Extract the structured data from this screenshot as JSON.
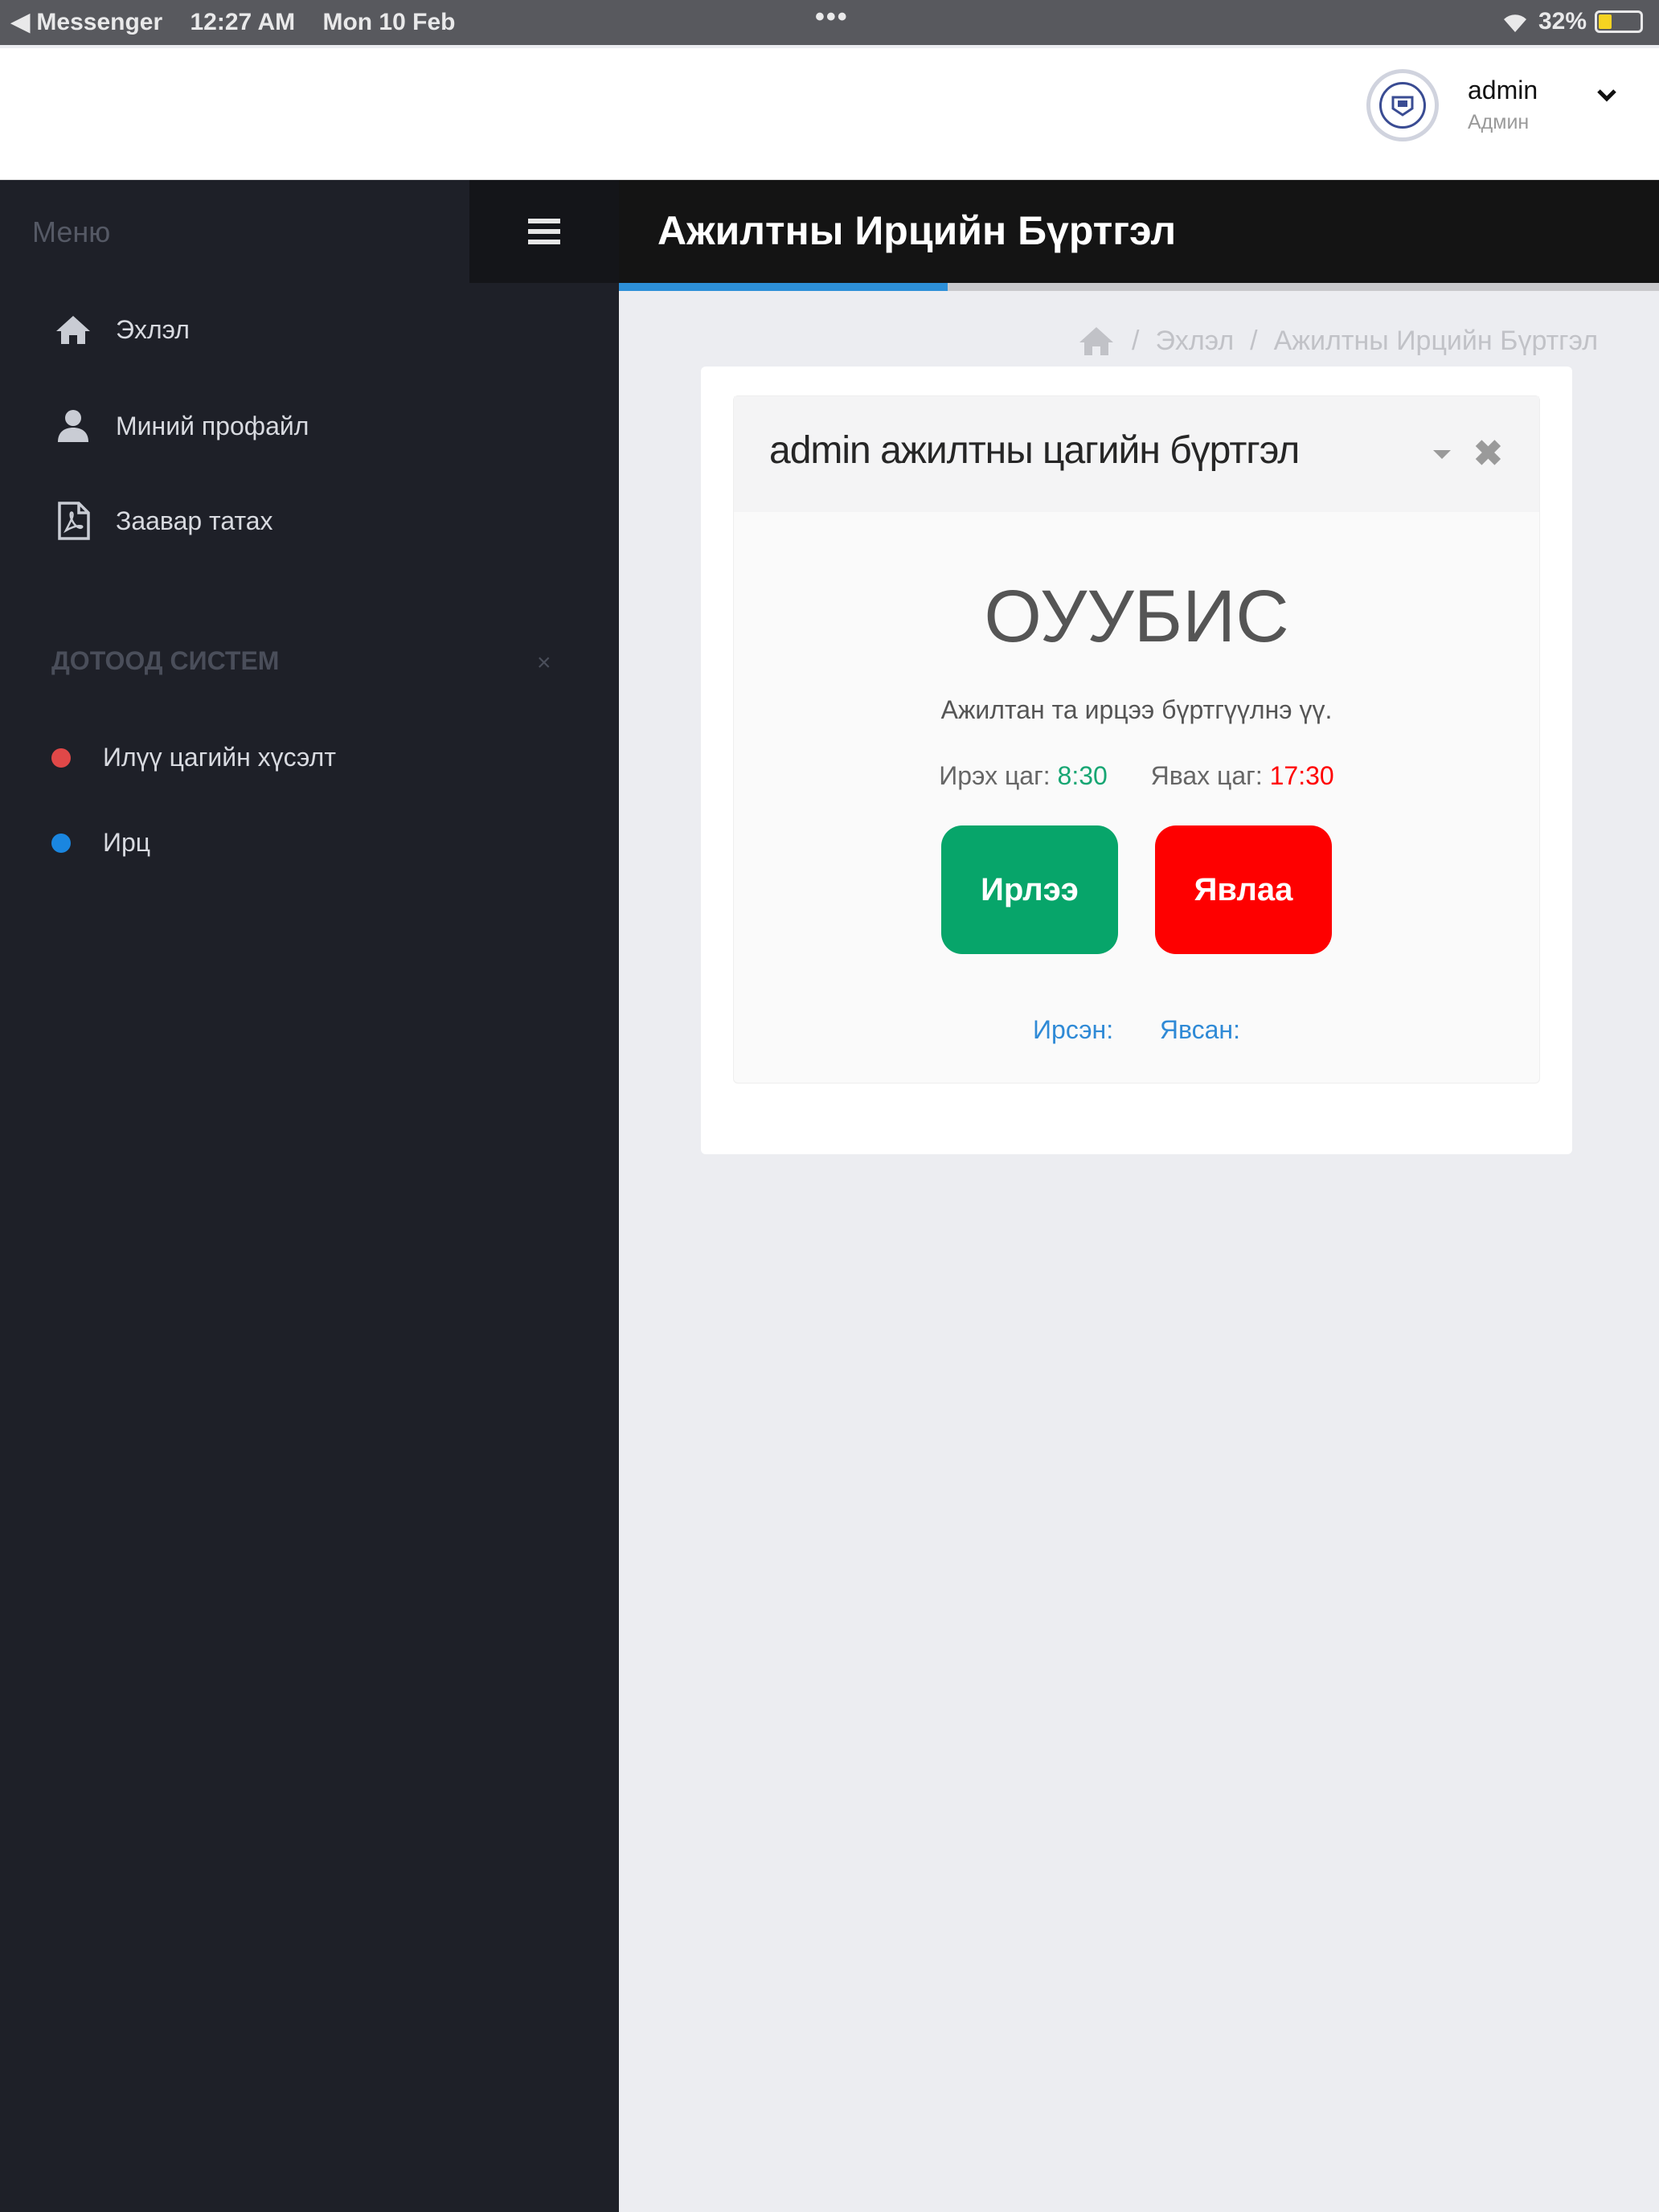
{
  "statusbar": {
    "back_app": "◀ Messenger",
    "time": "12:27 AM",
    "date": "Mon 10 Feb",
    "dots": "•••",
    "battery": "32%",
    "battery_level": 0.32
  },
  "user": {
    "name": "admin",
    "role": "Админ"
  },
  "sidebar": {
    "menu_label": "Меню",
    "items": [
      {
        "label": "Эхлэл",
        "icon": "home-icon"
      },
      {
        "label": "Миний профайл",
        "icon": "user-icon"
      },
      {
        "label": "Заавар татах",
        "icon": "pdf-file-icon"
      }
    ],
    "section_title": "ДОТООД СИСТЕМ",
    "section_close": "×",
    "sub_items": [
      {
        "label": "Илүү цагийн хүсэлт",
        "color": "#e04848"
      },
      {
        "label": "Ирц",
        "color": "#1a86e0"
      }
    ]
  },
  "page": {
    "title": "Ажилтны Ирцийн Бүртгэл",
    "load_progress": 0.316,
    "progress_color": "#2d8fd8"
  },
  "breadcrumb": {
    "sep": "/",
    "items": [
      "Эхлэл",
      "Ажилтны Ирцийн Бүртгэл"
    ]
  },
  "attendance": {
    "box_title": "admin ажилтны цагийн бүртгэл",
    "brand": "ОУУБИС",
    "subtitle": "Ажилтан та ирцээ бүртгүүлнэ үү.",
    "arrive_label": "Ирэх цаг:",
    "arrive_time": "8:30",
    "arrive_color": "#17a673",
    "leave_label": "Явах цаг:",
    "leave_time": "17:30",
    "leave_color": "#ff0000",
    "arrived_button": "Ирлээ",
    "left_button": "Явлаа",
    "arrived_status": "Ирсэн:",
    "left_status": "Явсан:"
  }
}
